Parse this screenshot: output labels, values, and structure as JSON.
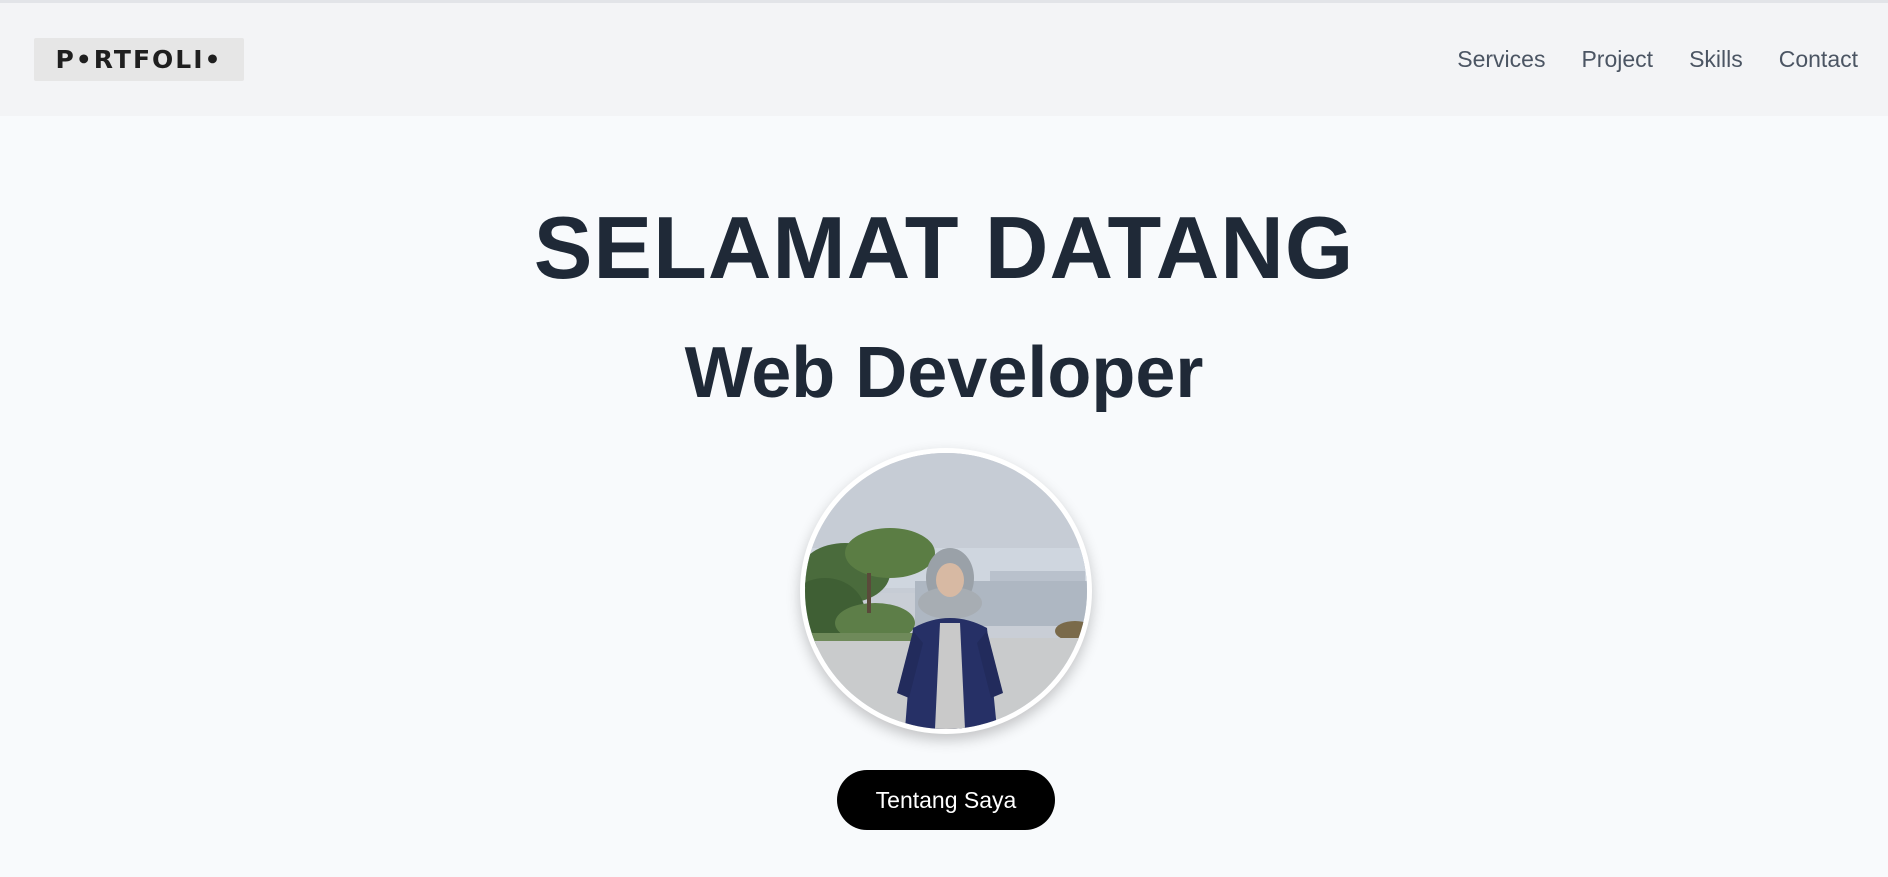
{
  "header": {
    "logo_text": "P•RTFOLI•",
    "nav": [
      {
        "label": "Services"
      },
      {
        "label": "Project"
      },
      {
        "label": "Skills"
      },
      {
        "label": "Contact"
      }
    ]
  },
  "hero": {
    "title": "SELAMAT DATANG",
    "subtitle": "Web Developer",
    "button_label": "Tentang Saya"
  },
  "colors": {
    "background": "#f8fafc",
    "header_bg": "#f3f4f6",
    "heading": "#1f2937",
    "nav_text": "#4b5563",
    "button_bg": "#000000",
    "button_text": "#ffffff"
  }
}
